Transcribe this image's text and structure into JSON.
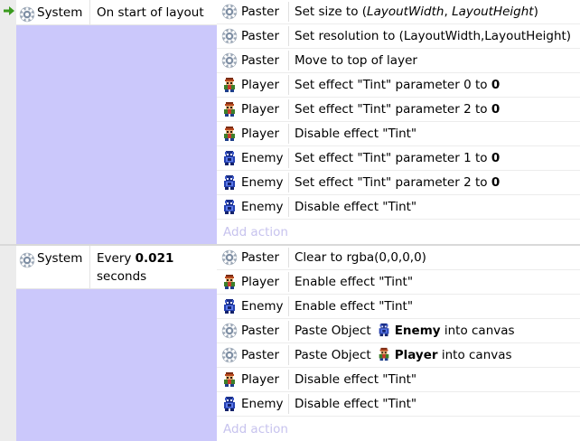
{
  "events": [
    {
      "condition": {
        "object": "System",
        "object_icon": "gear-icon",
        "text": "On start of layout",
        "is_trigger": true
      },
      "actions": [
        {
          "object": "Paster",
          "icon": "gear-icon",
          "pre": "Set size to (",
          "i1": "LayoutWidth",
          ",": ", ",
          "i2": "LayoutHeight",
          "post": ")"
        },
        {
          "object": "Paster",
          "icon": "gear-icon",
          "text": "Set resolution to (LayoutWidth,LayoutHeight)"
        },
        {
          "object": "Paster",
          "icon": "gear-icon",
          "text": "Move to top of layer"
        },
        {
          "object": "Player",
          "icon": "player-sprite-icon",
          "text": "Set effect \"Tint\" parameter 0 to ",
          "bold": "0"
        },
        {
          "object": "Player",
          "icon": "player-sprite-icon",
          "text": "Set effect \"Tint\" parameter 2 to ",
          "bold": "0"
        },
        {
          "object": "Player",
          "icon": "player-sprite-icon",
          "text": "Disable effect \"Tint\""
        },
        {
          "object": "Enemy",
          "icon": "enemy-sprite-icon",
          "text": "Set effect \"Tint\" parameter 1 to ",
          "bold": "0"
        },
        {
          "object": "Enemy",
          "icon": "enemy-sprite-icon",
          "text": "Set effect \"Tint\" parameter 2 to ",
          "bold": "0"
        },
        {
          "object": "Enemy",
          "icon": "enemy-sprite-icon",
          "text": "Disable effect \"Tint\""
        }
      ],
      "add_action": "Add action"
    },
    {
      "condition": {
        "object": "System",
        "object_icon": "gear-icon",
        "text_pre": "Every ",
        "text_bold": "0.021",
        "text_post": "seconds",
        "is_trigger": false
      },
      "actions": [
        {
          "object": "Paster",
          "icon": "gear-icon",
          "text": "Clear to rgba(0,0,0,0)"
        },
        {
          "object": "Player",
          "icon": "player-sprite-icon",
          "text": "Enable effect \"Tint\""
        },
        {
          "object": "Enemy",
          "icon": "enemy-sprite-icon",
          "text": "Enable effect \"Tint\""
        },
        {
          "object": "Paster",
          "icon": "gear-icon",
          "pre": "Paste Object",
          "param_icon": "enemy-sprite-icon",
          "param_bold": "Enemy",
          "post": "into canvas"
        },
        {
          "object": "Paster",
          "icon": "gear-icon",
          "pre": "Paste Object",
          "param_icon": "player-sprite-icon",
          "param_bold": "Player",
          "post": "into canvas"
        },
        {
          "object": "Player",
          "icon": "player-sprite-icon",
          "text": "Disable effect \"Tint\""
        },
        {
          "object": "Enemy",
          "icon": "enemy-sprite-icon",
          "text": "Disable effect \"Tint\""
        }
      ],
      "add_action": "Add action"
    }
  ],
  "colors": {
    "condition_area": "#cbc8fb",
    "add_action_text": "#c7c3ee",
    "trigger_arrow": "#3a9a1e"
  }
}
